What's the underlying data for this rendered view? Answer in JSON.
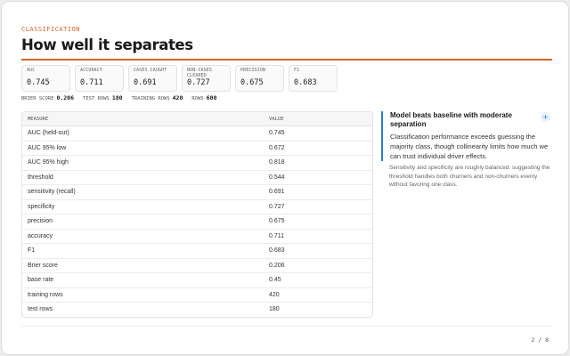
{
  "header": {
    "eyebrow": "CLASSIFICATION",
    "title": "How well it separates"
  },
  "kpis": [
    {
      "label": "AUC",
      "value": "0.745"
    },
    {
      "label": "ACCURACY",
      "value": "0.711"
    },
    {
      "label": "CASES CAUGHT",
      "value": "0.691"
    },
    {
      "label": "NON-CASES CLEARED",
      "value": "0.727"
    },
    {
      "label": "PRECISION",
      "value": "0.675"
    },
    {
      "label": "F1",
      "value": "0.683"
    }
  ],
  "stats": [
    {
      "label": "BRIER SCORE",
      "value": "0.206"
    },
    {
      "label": "TEST ROWS",
      "value": "180"
    },
    {
      "label": "TRAINING ROWS",
      "value": "420"
    },
    {
      "label": "ROWS",
      "value": "600"
    }
  ],
  "table": {
    "headers": [
      "MEASURE",
      "VALUE"
    ],
    "rows": [
      [
        "AUC (held-out)",
        "0.745"
      ],
      [
        "AUC 95% low",
        "0.672"
      ],
      [
        "AUC 95% high",
        "0.818"
      ],
      [
        "threshold",
        "0.544"
      ],
      [
        "sensitivity (recall)",
        "0.691"
      ],
      [
        "specificity",
        "0.727"
      ],
      [
        "precision",
        "0.675"
      ],
      [
        "accuracy",
        "0.711"
      ],
      [
        "F1",
        "0.683"
      ],
      [
        "Brier score",
        "0.206"
      ],
      [
        "base rate",
        "0.45"
      ],
      [
        "training rows",
        "420"
      ],
      [
        "test rows",
        "180"
      ]
    ]
  },
  "callout": {
    "title": "Model beats baseline with moderate separation",
    "body": "Classification performance exceeds guessing the majority class, though collinearity limits how much we can trust individual driver effects.",
    "plus": "+",
    "accent": "#2f7fd0"
  },
  "note": "Sensitivity and specificity are roughly balanced, suggesting the threshold handles both churners and non-churners evenly without favoring one class.",
  "footer": {
    "pager": "2 / 8"
  },
  "colors": {
    "accent": "#d2652a",
    "info": "#2f7fd0"
  }
}
